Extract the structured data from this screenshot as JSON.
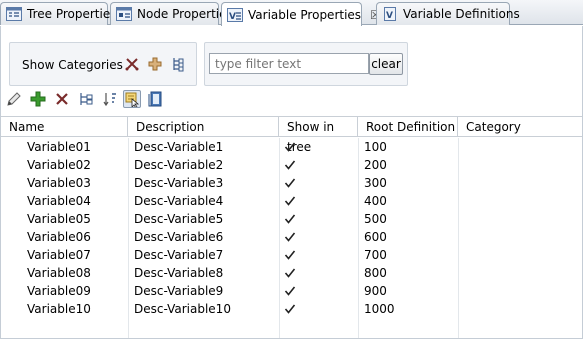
{
  "tabs": [
    {
      "label": "Tree Properties",
      "icon": "tree-properties-icon",
      "active": false
    },
    {
      "label": "Node Properties",
      "icon": "node-properties-icon",
      "active": false
    },
    {
      "label": "Variable Properties",
      "icon": "variable-properties-icon",
      "active": true,
      "close": "☒"
    },
    {
      "label": "Variable Definitions",
      "icon": "variable-definitions-icon",
      "active": false
    }
  ],
  "categories": {
    "label": "Show Categories",
    "icons": [
      "cut-icon",
      "add-category-icon",
      "tree-structure-icon"
    ]
  },
  "filter": {
    "placeholder": "type filter text",
    "value": "",
    "clear_label": "clear"
  },
  "toolbar": {
    "icons": [
      "edit-icon",
      "add-icon",
      "delete-icon",
      "hierarchy-icon",
      "sort-icon",
      "show-in-tree-icon",
      "book-icon"
    ]
  },
  "table": {
    "columns": [
      "Name",
      "Description",
      "Show in tree",
      "Root Definition",
      "Category"
    ],
    "rows": [
      {
        "name": "Variable01",
        "description": "Desc-Variable1",
        "show": true,
        "root": "100",
        "category": ""
      },
      {
        "name": "Variable02",
        "description": "Desc-Variable2",
        "show": true,
        "root": "200",
        "category": ""
      },
      {
        "name": "Variable03",
        "description": "Desc-Variable3",
        "show": true,
        "root": "300",
        "category": ""
      },
      {
        "name": "Variable04",
        "description": "Desc-Variable4",
        "show": true,
        "root": "400",
        "category": ""
      },
      {
        "name": "Variable05",
        "description": "Desc-Variable5",
        "show": true,
        "root": "500",
        "category": ""
      },
      {
        "name": "Variable06",
        "description": "Desc-Variable6",
        "show": true,
        "root": "600",
        "category": ""
      },
      {
        "name": "Variable07",
        "description": "Desc-Variable7",
        "show": true,
        "root": "700",
        "category": ""
      },
      {
        "name": "Variable08",
        "description": "Desc-Variable8",
        "show": true,
        "root": "800",
        "category": ""
      },
      {
        "name": "Variable09",
        "description": "Desc-Variable9",
        "show": true,
        "root": "900",
        "category": ""
      },
      {
        "name": "Variable10",
        "description": "Desc-Variable10",
        "show": true,
        "root": "1000",
        "category": ""
      }
    ]
  },
  "colors": {
    "accent_green": "#3a9b2e",
    "delete_red": "#c0392b",
    "grid_line": "#c9cfd6"
  }
}
